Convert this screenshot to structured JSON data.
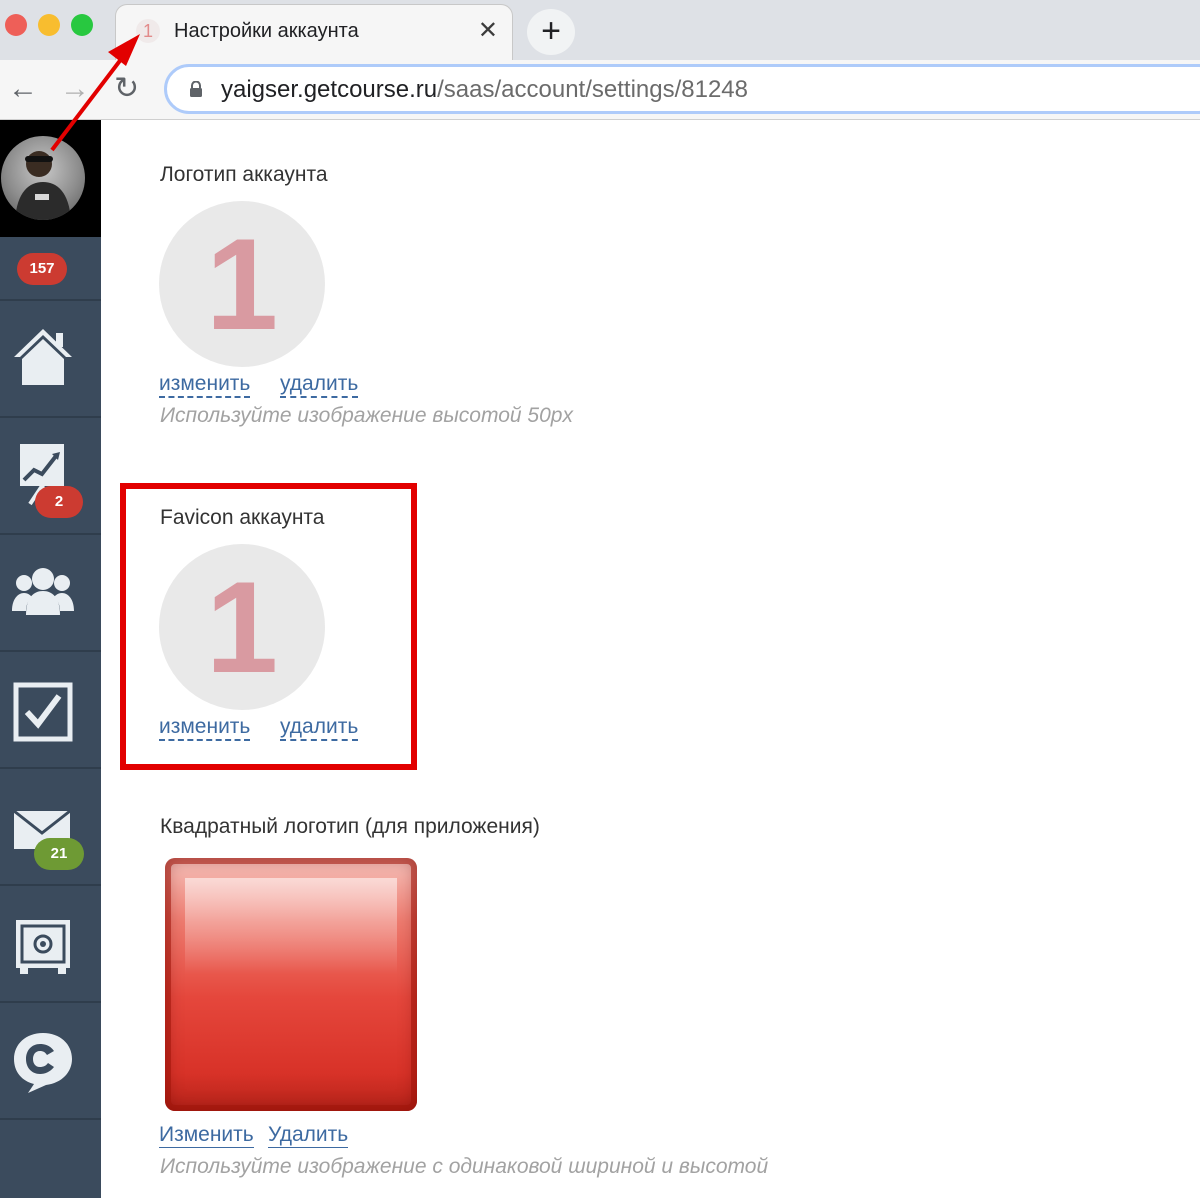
{
  "browser": {
    "tab": {
      "favicon_text": "1",
      "title": "Настройки аккаунта",
      "close_glyph": "✕"
    },
    "new_tab_glyph": "+",
    "nav": {
      "back_glyph": "←",
      "forward_glyph": "→",
      "reload_glyph": "↻"
    },
    "url": {
      "host": "yaigser.getcourse.ru",
      "path": "/saas/account/settings/81248"
    }
  },
  "sidebar": {
    "badges": {
      "notifications": "157",
      "stats": "2",
      "messages": "21"
    },
    "items": [
      {
        "icon": "home-icon"
      },
      {
        "icon": "chart-icon"
      },
      {
        "icon": "users-icon"
      },
      {
        "icon": "tasks-icon"
      },
      {
        "icon": "mail-icon"
      },
      {
        "icon": "safe-icon"
      },
      {
        "icon": "chat-icon"
      }
    ]
  },
  "main": {
    "logo_section": {
      "title": "Логотип аккаунта",
      "preview_text": "1",
      "change_label": "изменить",
      "delete_label": "удалить",
      "hint": "Используйте изображение высотой 50px"
    },
    "favicon_section": {
      "title": "Favicon аккаунта",
      "preview_text": "1",
      "change_label": "изменить",
      "delete_label": "удалить"
    },
    "square_logo_section": {
      "title": "Квадратный логотип (для приложения)",
      "change_label": "Изменить",
      "delete_label": "Удалить",
      "hint": "Используйте изображение с одинаковой шириной и высотой"
    }
  },
  "colors": {
    "highlight": "#e20000",
    "arrow": "#e20000",
    "link": "#3d6aa1",
    "sidebar": "#3b4b5d",
    "badge_red": "#cc3b31",
    "badge_green": "#6e9a34"
  }
}
